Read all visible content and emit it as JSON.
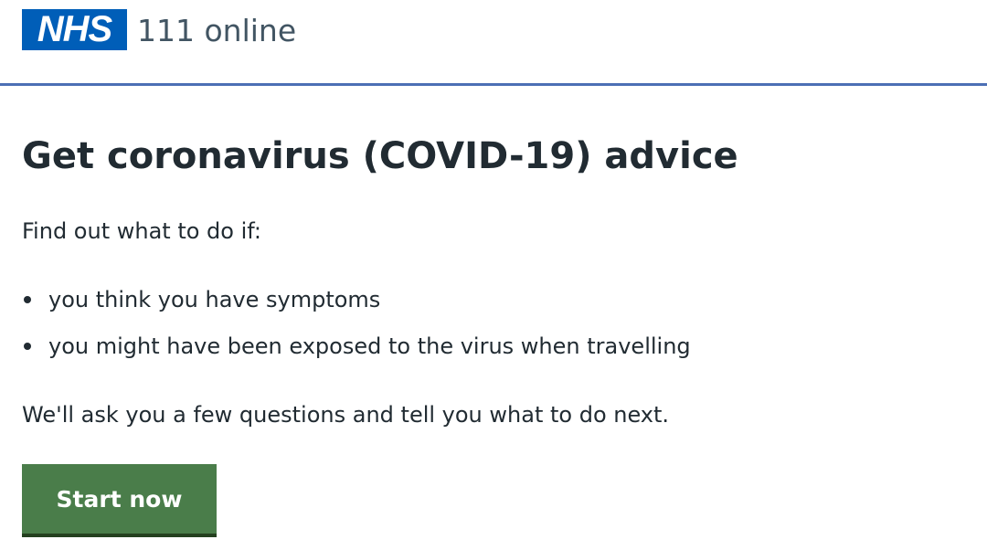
{
  "header": {
    "logo_text": "NHS",
    "service_name": "111 online"
  },
  "main": {
    "title": "Get coronavirus (COVID-19) advice",
    "intro": "Find out what to do if:",
    "bullets": [
      "you think you have symptoms",
      "you might have been exposed to the virus when travelling"
    ],
    "outro": "We'll ask you a few questions and tell you what to do next.",
    "start_button": "Start now"
  },
  "colors": {
    "nhs_blue": "#005eb8",
    "header_rule": "#4c6fb5",
    "button_green": "#4a7d4a",
    "text": "#212b32"
  }
}
